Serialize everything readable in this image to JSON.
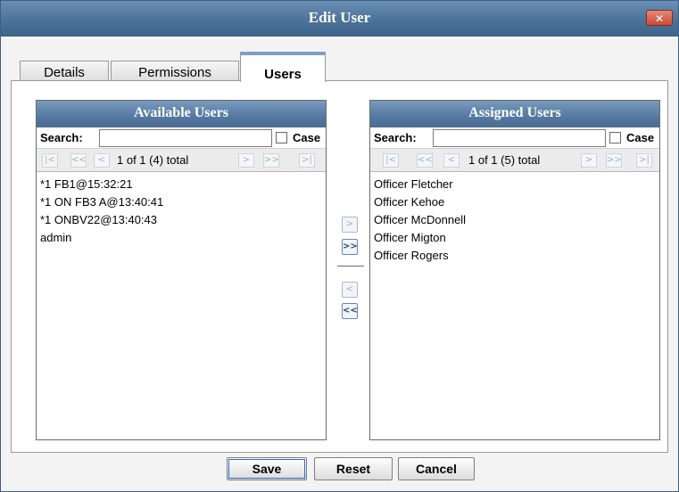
{
  "dialog": {
    "title": "Edit User",
    "close_glyph": "✕"
  },
  "tabs": [
    {
      "label": "Details",
      "active": false
    },
    {
      "label": "Permissions",
      "active": false
    },
    {
      "label": "Users",
      "active": true
    }
  ],
  "available": {
    "title": "Available Users",
    "search_label": "Search:",
    "search_value": "",
    "case_label": "Case",
    "pager_text": "1 of 1 (4) total",
    "items": [
      "*1 FB1@15:32:21",
      "*1 ON FB3 A@13:40:41",
      "*1 ONBV22@13:40:43",
      "admin"
    ]
  },
  "assigned": {
    "title": "Assigned Users",
    "search_label": "Search:",
    "search_value": "",
    "case_label": "Case",
    "pager_text": "1 of 1 (5) total",
    "items": [
      "Officer Fletcher",
      "Officer Kehoe",
      "Officer McDonnell",
      "Officer Migton",
      "Officer Rogers"
    ]
  },
  "pager_glyphs": {
    "first": "|<",
    "prev_page": "<<",
    "prev": "<",
    "next": ">",
    "next_page": ">>",
    "last": ">|"
  },
  "mover_glyphs": {
    "add": ">",
    "add_all": ">>",
    "remove": "<",
    "remove_all": "<<"
  },
  "buttons": {
    "save": "Save",
    "reset": "Reset",
    "cancel": "Cancel"
  },
  "colors": {
    "title_bar": "#4c7299",
    "header": "#5478a0",
    "close": "#c74b35",
    "focus": "#2a6fbf"
  }
}
